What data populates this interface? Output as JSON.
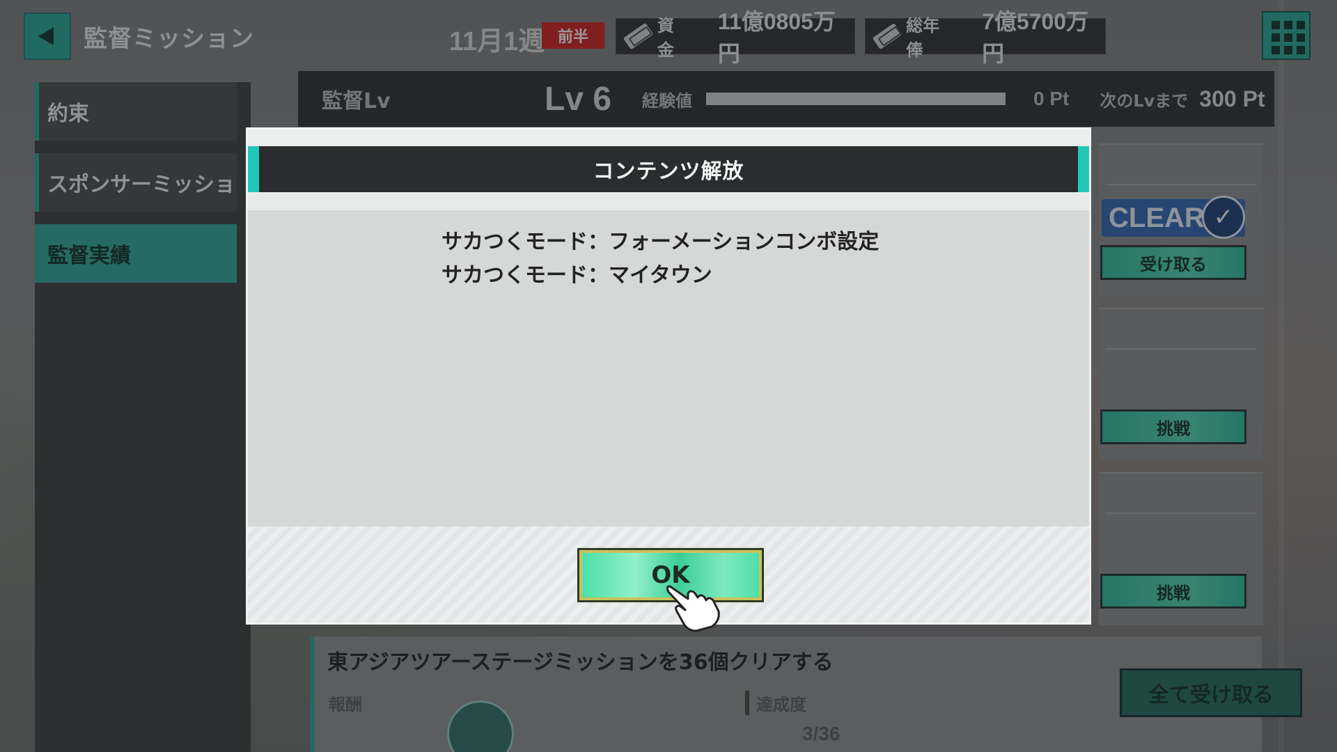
{
  "header": {
    "title": "監督ミッション",
    "week": "11月1週",
    "half": "前半",
    "funds": {
      "label": "資金",
      "value": "11億0805万円"
    },
    "salary": {
      "label": "総年俸",
      "value": "7億5700万円"
    }
  },
  "sidebar": {
    "items": [
      {
        "label": "約束"
      },
      {
        "label": "スポンサーミッション"
      },
      {
        "label": "監督実績"
      }
    ]
  },
  "level_bar": {
    "label": "監督Lv",
    "level": "Lv 6",
    "exp_label": "経験値",
    "exp_value": "0 Pt",
    "exp_progress": 0,
    "next_label": "次のLvまで",
    "next_value": "300 Pt"
  },
  "right_cards": {
    "clear_text": "CLEAR!",
    "receive_label": "受け取る",
    "challenge_label_1": "挑戦",
    "challenge_label_2": "挑戦"
  },
  "mission": {
    "text": "東アジアツアーステージミッションを36個クリアする",
    "reward_label": "報酬",
    "achievement_label": "達成度",
    "achievement_value": "3/36"
  },
  "receive_all_label": "全て受け取る",
  "modal": {
    "title": "コンテンツ解放",
    "items": [
      "サカつくモード：フォーメーションコンボ設定",
      "サカつくモード：マイタウン"
    ],
    "ok_label": "OK"
  },
  "colors": {
    "accent": "#23a896",
    "modal_header_accent": "#22c7b8",
    "badge_red": "#d11f1f",
    "clear_blue": "#2e66b5",
    "ok_green": "#4de0a8"
  },
  "icons": [
    "back-arrow-icon",
    "money-icon",
    "grid-menu-icon",
    "check-icon",
    "pointer-hand-icon"
  ]
}
